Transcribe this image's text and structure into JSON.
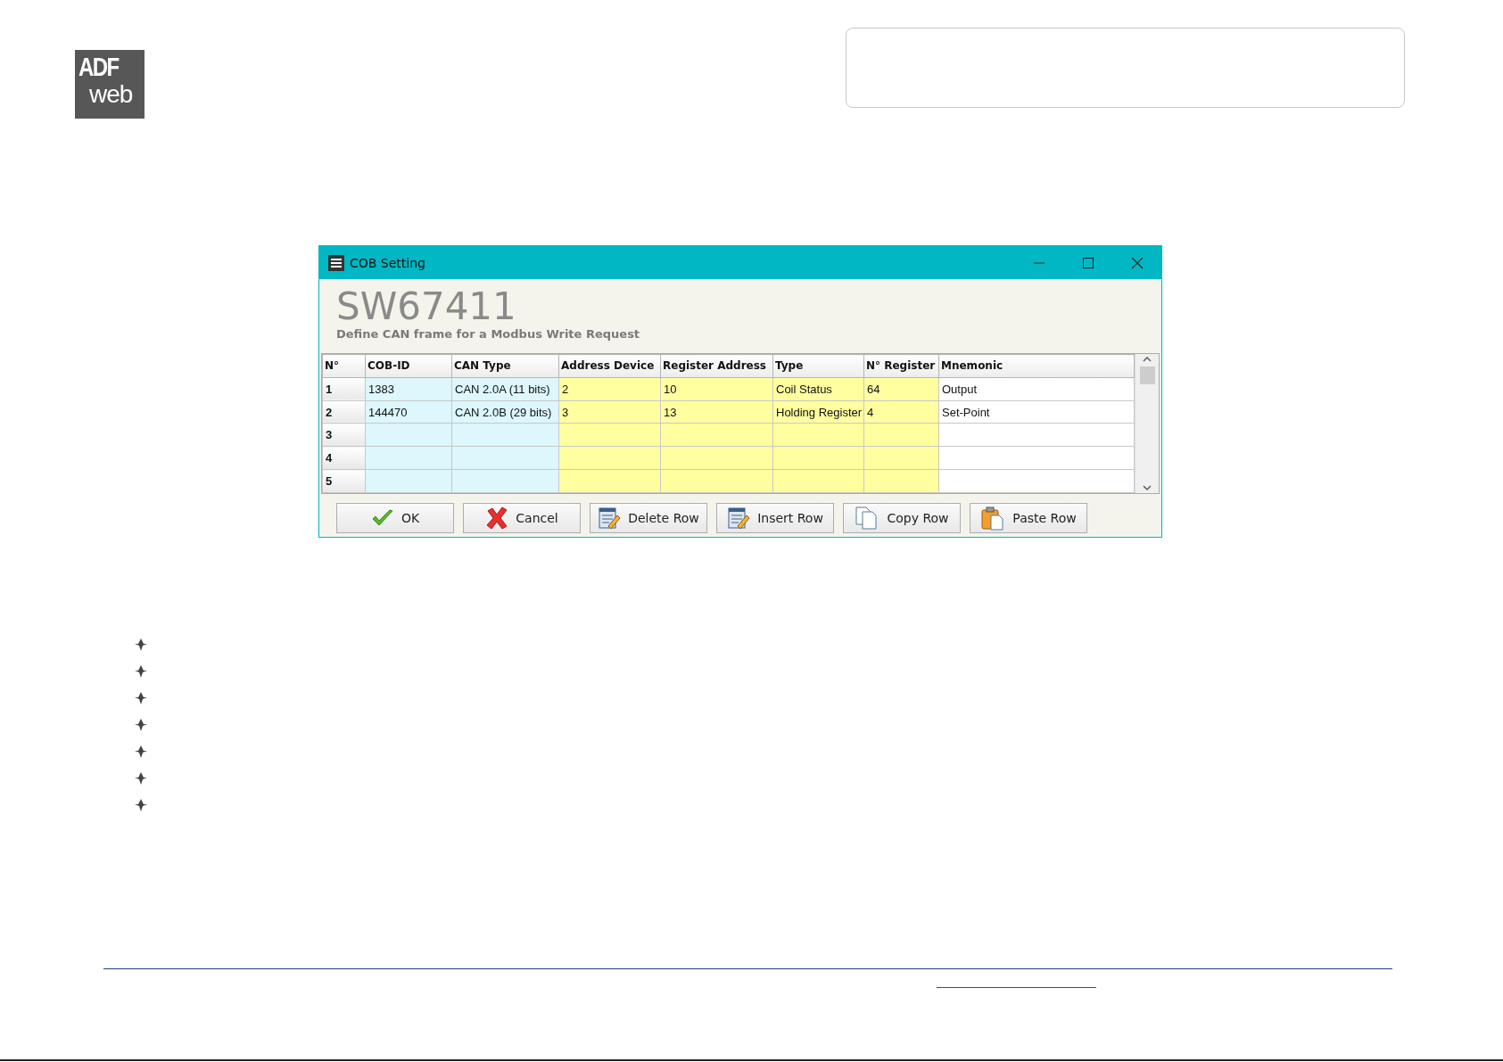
{
  "logo": {
    "line_1": "ADF",
    "line_2": "web"
  },
  "window": {
    "title": "COB Setting",
    "heading": "SW67411",
    "subtitle": "Define CAN frame for a Modbus Write Request"
  },
  "table": {
    "columns": [
      {
        "label": "N°",
        "kind": "index"
      },
      {
        "label": "COB-ID",
        "kind": "can"
      },
      {
        "label": "CAN Type",
        "kind": "can"
      },
      {
        "label": "Address Device",
        "kind": "modbus"
      },
      {
        "label": "Register Address",
        "kind": "modbus"
      },
      {
        "label": "Type",
        "kind": "modbus"
      },
      {
        "label": "N° Register",
        "kind": "modbus"
      },
      {
        "label": "Mnemonic",
        "kind": "text"
      }
    ],
    "rows": [
      {
        "number": "1",
        "cells": [
          "1383",
          "CAN 2.0A (11 bits)",
          "2",
          "10",
          "Coil Status",
          "64",
          "Output"
        ]
      },
      {
        "number": "2",
        "cells": [
          "144470",
          "CAN 2.0B (29 bits)",
          "3",
          "13",
          "Holding Register",
          "4",
          "Set-Point"
        ]
      },
      {
        "number": "3"
      },
      {
        "number": "4"
      },
      {
        "number": "5"
      }
    ]
  },
  "buttons": [
    {
      "label": "OK",
      "kind": "ok"
    },
    {
      "label": "Cancel",
      "kind": "cancel"
    },
    {
      "label": "Delete Row",
      "kind": "delete"
    },
    {
      "label": "Insert Row",
      "kind": "insert"
    },
    {
      "label": "Copy Row",
      "kind": "copy"
    },
    {
      "label": "Paste Row",
      "kind": "paste"
    }
  ],
  "bullet_count_items": [
    {
      "kind": "bullet"
    },
    {
      "kind": "bullet"
    },
    {
      "kind": "bullet"
    },
    {
      "kind": "bullet"
    },
    {
      "kind": "bullet"
    },
    {
      "kind": "bullet"
    },
    {
      "kind": "bullet"
    }
  ]
}
